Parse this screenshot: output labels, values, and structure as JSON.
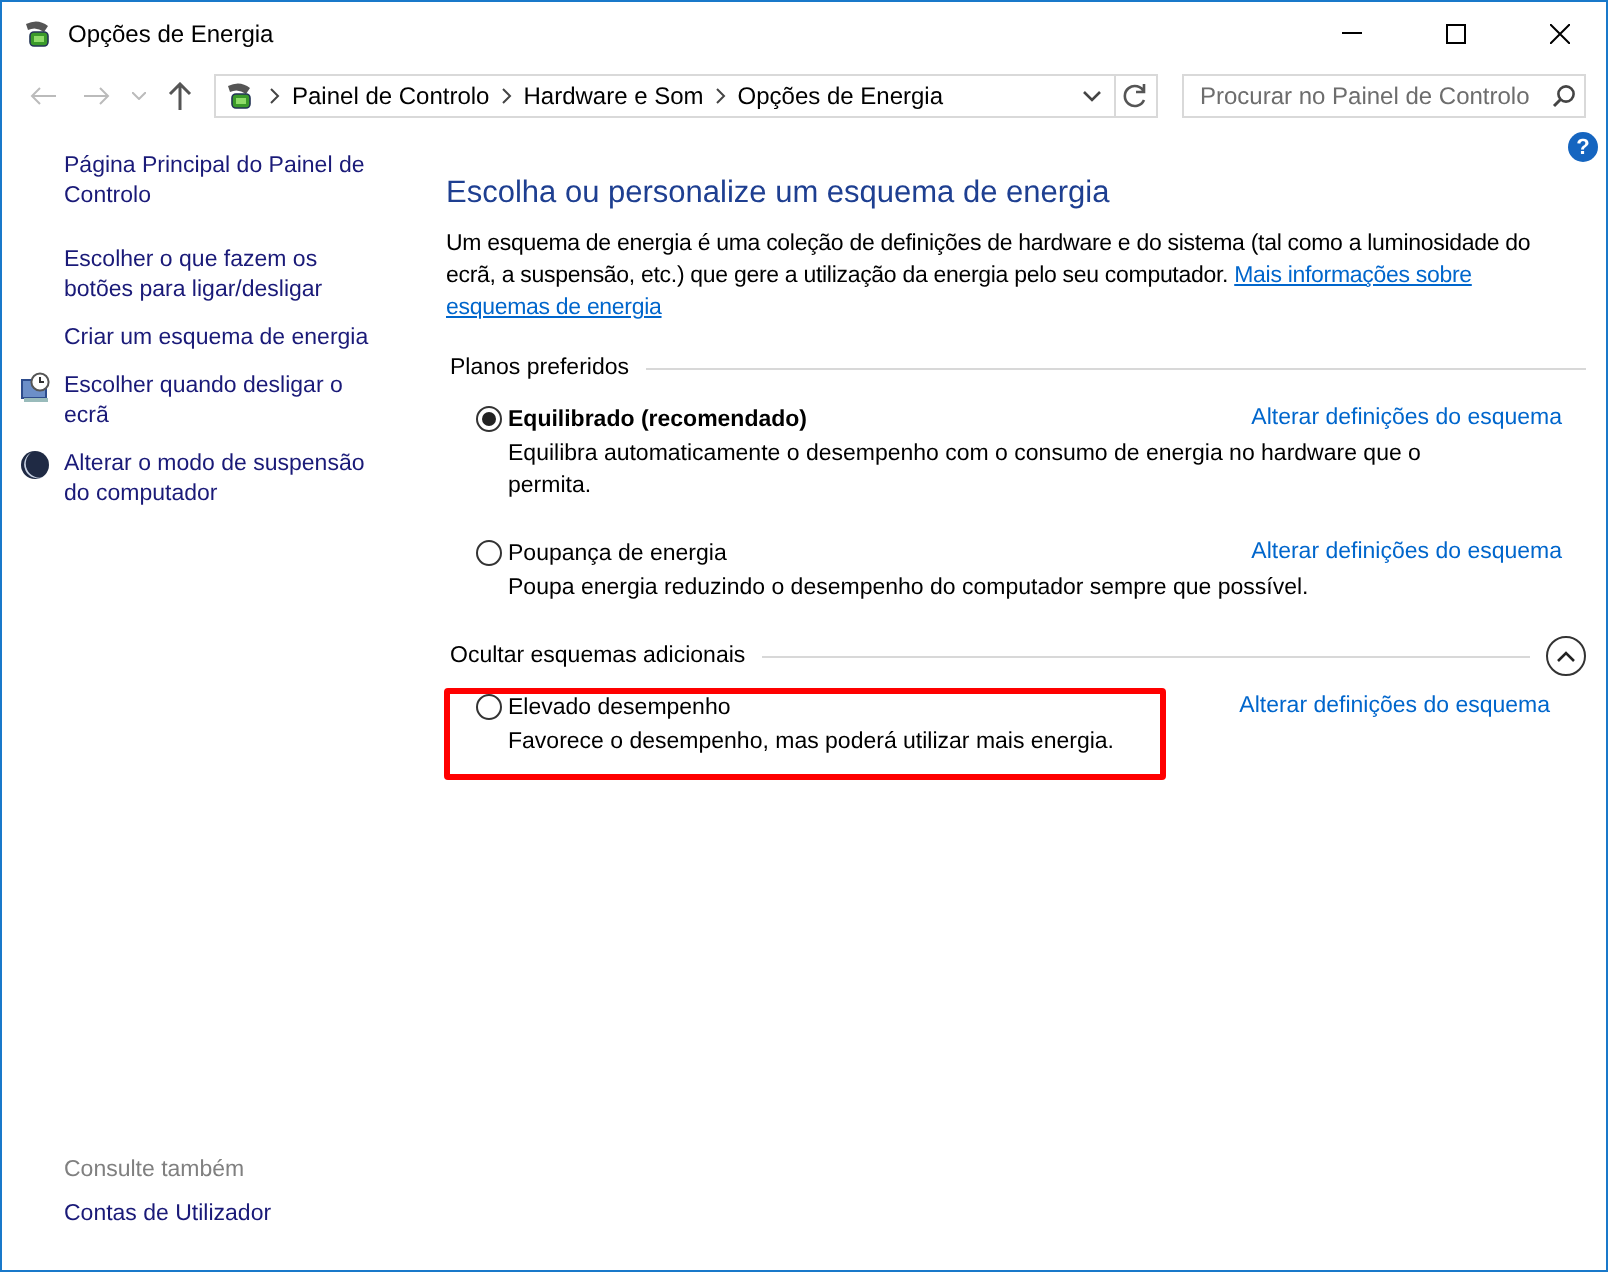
{
  "window": {
    "title": "Opções de Energia"
  },
  "nav": {
    "breadcrumbs": [
      "Painel de Controlo",
      "Hardware e Som",
      "Opções de Energia"
    ],
    "search": {
      "placeholder": "Procurar no Painel de Controlo"
    }
  },
  "sidebar": {
    "items": [
      {
        "label": "Página Principal do Painel de Controlo",
        "kind": "home"
      },
      {
        "label": "Escolher o que fazem os botões para ligar/desligar",
        "kind": "link"
      },
      {
        "label": "Criar um esquema de energia",
        "kind": "link"
      },
      {
        "label": "Escolher quando desligar o ecrã",
        "kind": "display"
      },
      {
        "label": "Alterar o modo de suspensão do computador",
        "kind": "sleep"
      }
    ],
    "see_also": {
      "heading": "Consulte também",
      "items": [
        "Contas de Utilizador"
      ]
    }
  },
  "help": "?",
  "main": {
    "heading": "Escolha ou personalize um esquema de energia",
    "description": "Um esquema de energia é uma coleção de definições de hardware e do sistema (tal como a luminosidade do ecrã, a suspensão, etc.) que gere a utilização da energia pelo seu computador.",
    "more_link": "Mais informações sobre esquemas de energia",
    "groups": [
      {
        "label": "Planos preferidos",
        "plans": [
          {
            "name": "Equilibrado (recomendado)",
            "selected": true,
            "highlighted": false,
            "description": "Equilibra automaticamente o desempenho com o consumo de energia no hardware que o permita.",
            "link": "Alterar definições do esquema"
          },
          {
            "name": "Poupança de energia",
            "selected": false,
            "highlighted": false,
            "description": "Poupa energia reduzindo o desempenho do computador sempre que possível.",
            "link": "Alterar definições do esquema"
          }
        ]
      },
      {
        "label": "Ocultar esquemas adicionais",
        "expanded": true,
        "plans": [
          {
            "name": "Elevado desempenho",
            "selected": false,
            "highlighted": true,
            "description": "Favorece o desempenho, mas poderá utilizar mais energia.",
            "link": "Alterar definições do esquema"
          }
        ]
      }
    ]
  }
}
